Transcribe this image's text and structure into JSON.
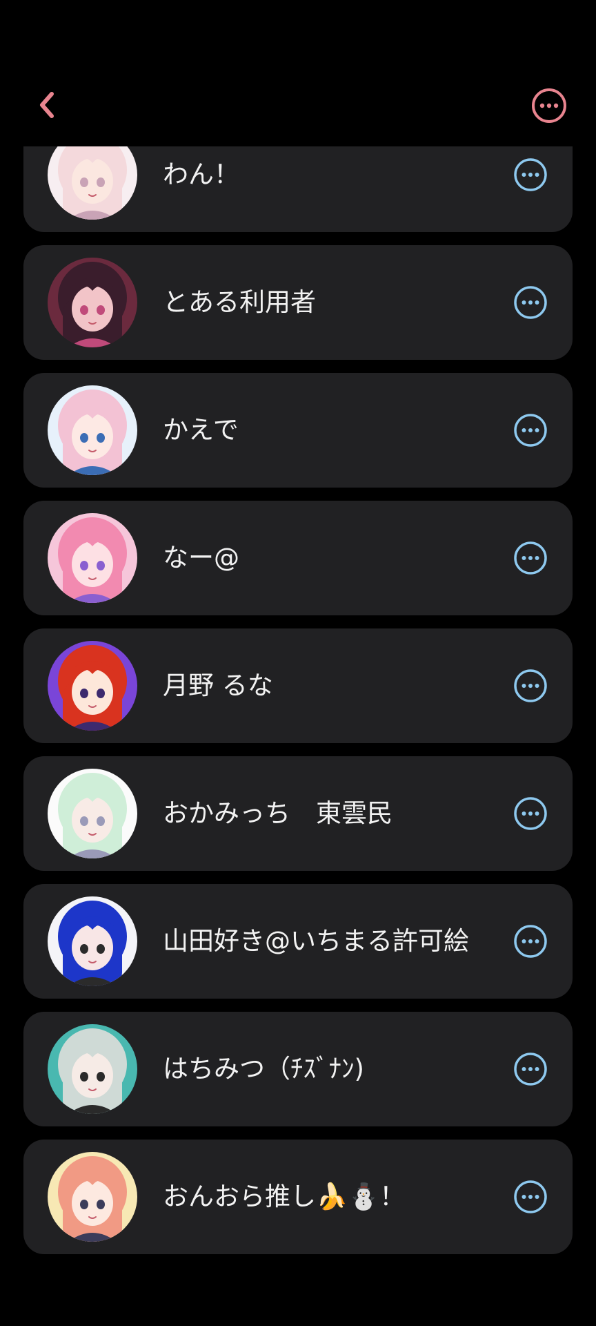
{
  "header": {
    "back_icon": "chevron-left-icon",
    "more_icon": "more-horizontal-circle-icon",
    "accent_color": "#e8848f"
  },
  "row_more_color": "#8ec9ef",
  "row_background": "#212123",
  "users": [
    {
      "name": "わん！",
      "avatar_hair": "#f4d9dc",
      "avatar_bg": "#f7eef1",
      "avatar_skin": "#fbe7e0",
      "avatar_accent": "#c9a3b6"
    },
    {
      "name": "とある利用者",
      "avatar_hair": "#3a1d2c",
      "avatar_bg": "#6b2a3e",
      "avatar_skin": "#f2c4c8",
      "avatar_accent": "#c04a7a"
    },
    {
      "name": "かえで",
      "avatar_hair": "#f3c2d4",
      "avatar_bg": "#e7f1fb",
      "avatar_skin": "#fde9e4",
      "avatar_accent": "#3b6db5"
    },
    {
      "name": "なー@",
      "avatar_hair": "#f28ab0",
      "avatar_bg": "#f6c6da",
      "avatar_skin": "#fde0e4",
      "avatar_accent": "#8a5fd0"
    },
    {
      "name": "月野 るな",
      "avatar_hair": "#d9331f",
      "avatar_bg": "#7a45d8",
      "avatar_skin": "#fde7da",
      "avatar_accent": "#3d2a6e"
    },
    {
      "name": "おかみっち　東雲民",
      "avatar_hair": "#cfeed8",
      "avatar_bg": "#fbfbfb",
      "avatar_skin": "#f8ebe6",
      "avatar_accent": "#9a9ab8"
    },
    {
      "name": "山田好き@いちまる許可絵",
      "avatar_hair": "#1d36c9",
      "avatar_bg": "#f4f4f8",
      "avatar_skin": "#f8e6e6",
      "avatar_accent": "#2b2b2b"
    },
    {
      "name": "はちみつ（ﾁｽﾞﾅﾝ)",
      "avatar_hair": "#cfdad6",
      "avatar_bg": "#49b8b0",
      "avatar_skin": "#f6ebe6",
      "avatar_accent": "#2a2a2a"
    },
    {
      "name": "おんおら推し🍌⛄！",
      "avatar_hair": "#f19a84",
      "avatar_bg": "#f7e8b4",
      "avatar_skin": "#fde9e0",
      "avatar_accent": "#3c3c5a"
    }
  ]
}
